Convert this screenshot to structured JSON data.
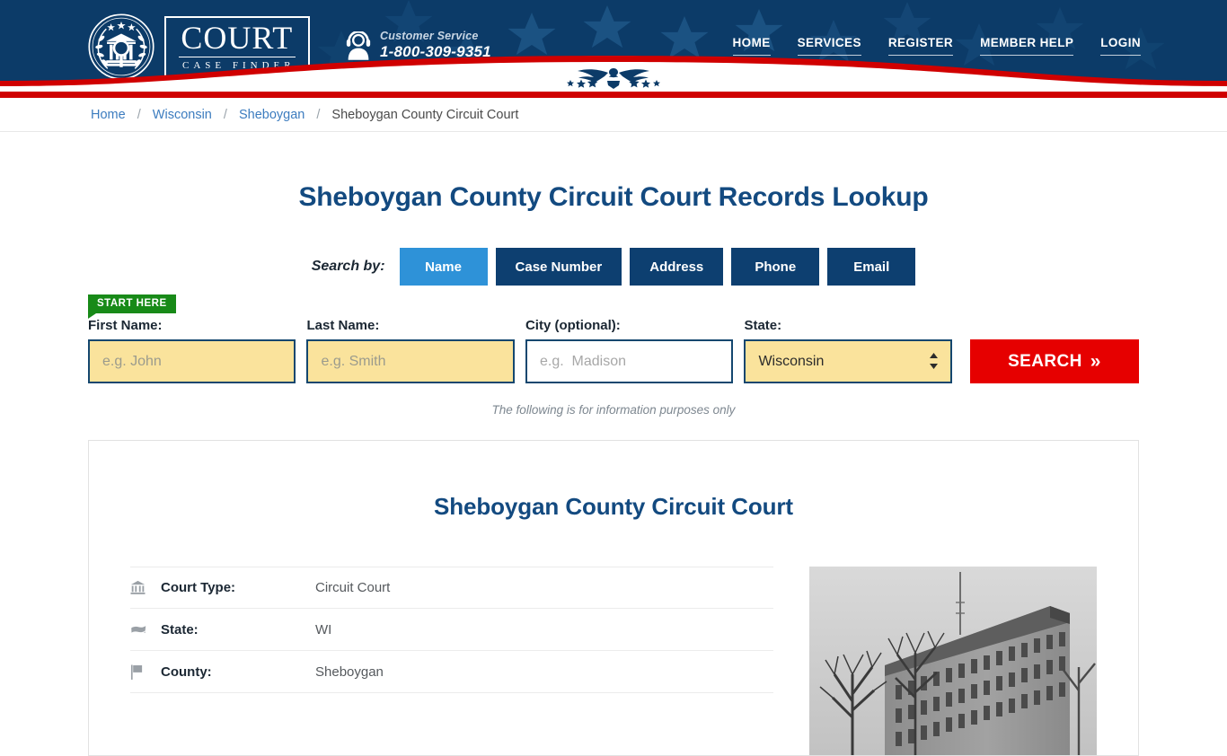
{
  "header": {
    "logo": {
      "seal_icon": "court-seal-icon",
      "word_top": "COURT",
      "word_bottom": "CASE FINDER"
    },
    "customer_service": {
      "icon": "headset-agent-icon",
      "label": "Customer Service",
      "phone": "1-800-309-9351"
    },
    "nav": [
      {
        "label": "HOME"
      },
      {
        "label": "SERVICES"
      },
      {
        "label": "REGISTER"
      },
      {
        "label": "MEMBER HELP"
      },
      {
        "label": "LOGIN"
      }
    ],
    "banner_icon": "eagle-emblem-icon",
    "colors": {
      "navy": "#0c3b68",
      "star": "#1b5282",
      "red": "#d00000",
      "white": "#ffffff"
    }
  },
  "breadcrumb": {
    "items": [
      {
        "label": "Home",
        "link": true
      },
      {
        "label": "Wisconsin",
        "link": true
      },
      {
        "label": "Sheboygan",
        "link": true
      },
      {
        "label": "Sheboygan County Circuit Court",
        "link": false
      }
    ],
    "separator": "/"
  },
  "main": {
    "page_title": "Sheboygan County Circuit Court Records Lookup",
    "search_by_label": "Search by:",
    "tabs": [
      {
        "label": "Name",
        "active": true
      },
      {
        "label": "Case Number",
        "active": false
      },
      {
        "label": "Address",
        "active": false
      },
      {
        "label": "Phone",
        "active": false
      },
      {
        "label": "Email",
        "active": false
      }
    ],
    "start_here_badge": "START HERE",
    "form": {
      "first_name": {
        "label": "First Name:",
        "placeholder": "e.g. John",
        "value": ""
      },
      "last_name": {
        "label": "Last Name:",
        "placeholder": "e.g. Smith",
        "value": ""
      },
      "city": {
        "label": "City (optional):",
        "placeholder": "e.g.  Madison",
        "value": ""
      },
      "state": {
        "label": "State:",
        "value": "Wisconsin"
      },
      "search_button": "SEARCH",
      "search_button_chevron": "»"
    },
    "disclaimer": "The following is for information purposes only",
    "accent_colors": {
      "tab_active": "#2e92d8",
      "tab_inactive": "#0d3f70",
      "field_yellow": "#fae39c",
      "field_border": "#14476f",
      "search_red": "#e60000",
      "badge_green": "#188a18",
      "heading_blue": "#134a80"
    }
  },
  "card": {
    "title": "Sheboygan County Circuit Court",
    "details": [
      {
        "icon": "bank-building-icon",
        "label": "Court Type:",
        "value": "Circuit Court"
      },
      {
        "icon": "us-map-icon",
        "label": "State:",
        "value": "WI"
      },
      {
        "icon": "flag-icon",
        "label": "County:",
        "value": "Sheboygan"
      }
    ],
    "photo": {
      "icon": "courthouse-photo",
      "alt": "Black and white photograph of the Sheboygan County courthouse building with bare trees"
    }
  }
}
